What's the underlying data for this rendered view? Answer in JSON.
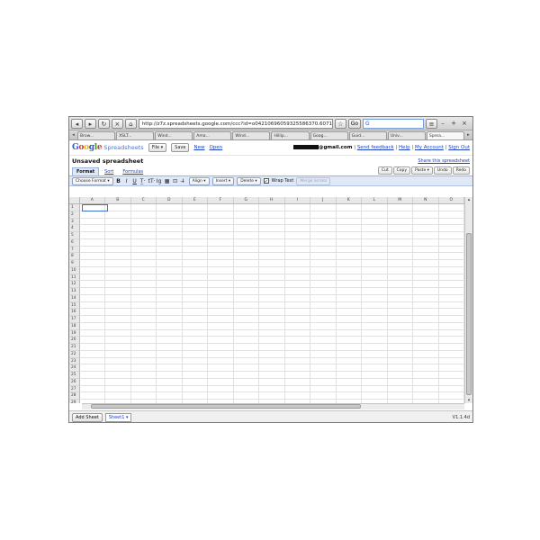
{
  "browser": {
    "nav_buttons": [
      "back-icon",
      "forward-icon",
      "reload-icon",
      "stop-icon",
      "home-icon"
    ],
    "url": "http://z7z.spreadsheets.google.com/ccc?id=o04210696059325586370.6071784131",
    "go_label": "Go",
    "search_value": "G",
    "window_controls": [
      "–",
      "+",
      "×"
    ],
    "tabs": [
      {
        "label": "Brow..."
      },
      {
        "label": "XSLT..."
      },
      {
        "label": "Wind..."
      },
      {
        "label": "Ama..."
      },
      {
        "label": "Wind..."
      },
      {
        "label": "Hillip..."
      },
      {
        "label": "Goog..."
      },
      {
        "label": "Guid..."
      },
      {
        "label": "Univ..."
      },
      {
        "label": "Sprea..."
      }
    ]
  },
  "header": {
    "logo_parts": [
      "G",
      "o",
      "o",
      "g",
      "l",
      "e"
    ],
    "product": "Spreadsheets",
    "file_label": "File ▾",
    "save_label": "Save",
    "new_label": "New",
    "open_label": "Open",
    "email_suffix": "@gmail.com",
    "separator": "|",
    "send_feedback": "Send feedback",
    "help": "Help",
    "my_account": "My Account",
    "sign_out": "Sign Out"
  },
  "doc": {
    "title": "Unsaved spreadsheet",
    "share": "Share this spreadsheet"
  },
  "menu": {
    "tabs": [
      "Format",
      "Sort",
      "Formulas"
    ],
    "edit_buttons": [
      "Cut",
      "Copy",
      "Paste ▾",
      "Undo",
      "Redo"
    ]
  },
  "toolbar": {
    "choose_format": "Choose Format ▾",
    "icons": {
      "bold": "B",
      "italic": "I",
      "underline": "U",
      "font_size": "T̲·",
      "font": "tT·",
      "text_color": "Ig",
      "bg_color": "▦",
      "border": "⊡",
      "clear": "I̶"
    },
    "align": "Align ▾",
    "insert": "Insert ▾",
    "delete": "Delete ▾",
    "wrap_checked": "✓",
    "wrap_label": "Wrap Text",
    "merge_label": "Merge across"
  },
  "grid": {
    "columns": [
      "A",
      "B",
      "C",
      "D",
      "E",
      "F",
      "G",
      "H",
      "I",
      "J",
      "K",
      "L",
      "M",
      "N",
      "O"
    ],
    "rows": [
      "1",
      "2",
      "3",
      "4",
      "5",
      "6",
      "7",
      "8",
      "9",
      "10",
      "11",
      "12",
      "13",
      "14",
      "15",
      "16",
      "17",
      "18",
      "19",
      "20",
      "21",
      "22",
      "23",
      "24",
      "25",
      "26",
      "27",
      "28",
      "29",
      "30"
    ]
  },
  "footer": {
    "add_sheet": "Add Sheet",
    "sheet_tab": "Sheet1 ▾",
    "version": "V1.1.4d"
  }
}
